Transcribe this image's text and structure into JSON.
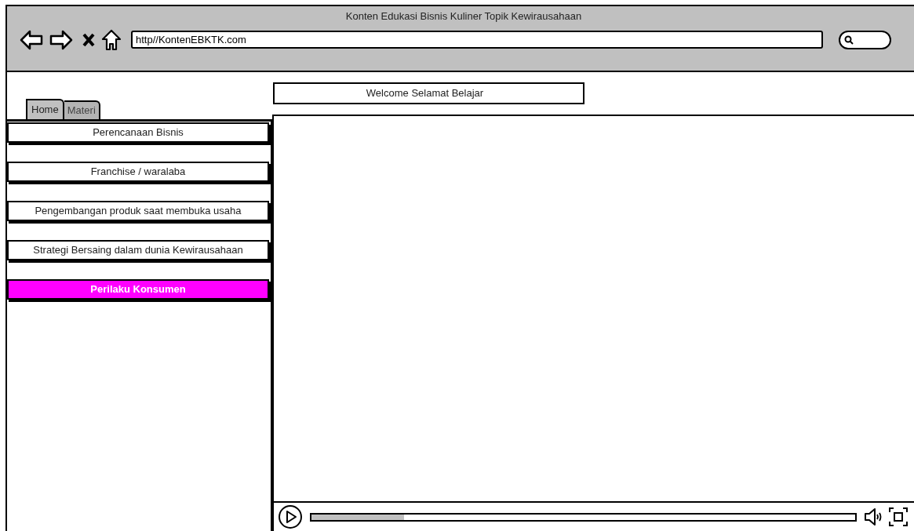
{
  "window": {
    "title": "Konten Edukasi Bisnis Kuliner Topik Kewirausahaan"
  },
  "address_bar": {
    "value": "http//KontenEBKTK.com"
  },
  "tabs": [
    {
      "label": "Home",
      "selected": true
    },
    {
      "label": "Materi",
      "selected": false
    }
  ],
  "sidebar": {
    "items": [
      {
        "label": "Perencanaan Bisnis",
        "selected": false
      },
      {
        "label": "Franchise / waralaba",
        "selected": false
      },
      {
        "label": "Pengembangan produk saat membuka usaha",
        "selected": false
      },
      {
        "label": "Strategi Bersaing dalam dunia Kewirausahaan",
        "selected": false
      },
      {
        "label": "Perilaku Konsumen",
        "selected": true
      }
    ]
  },
  "welcome": {
    "label": "Welcome Selamat Belajar"
  },
  "video_player": {
    "progress": {
      "level": 0.17
    }
  }
}
